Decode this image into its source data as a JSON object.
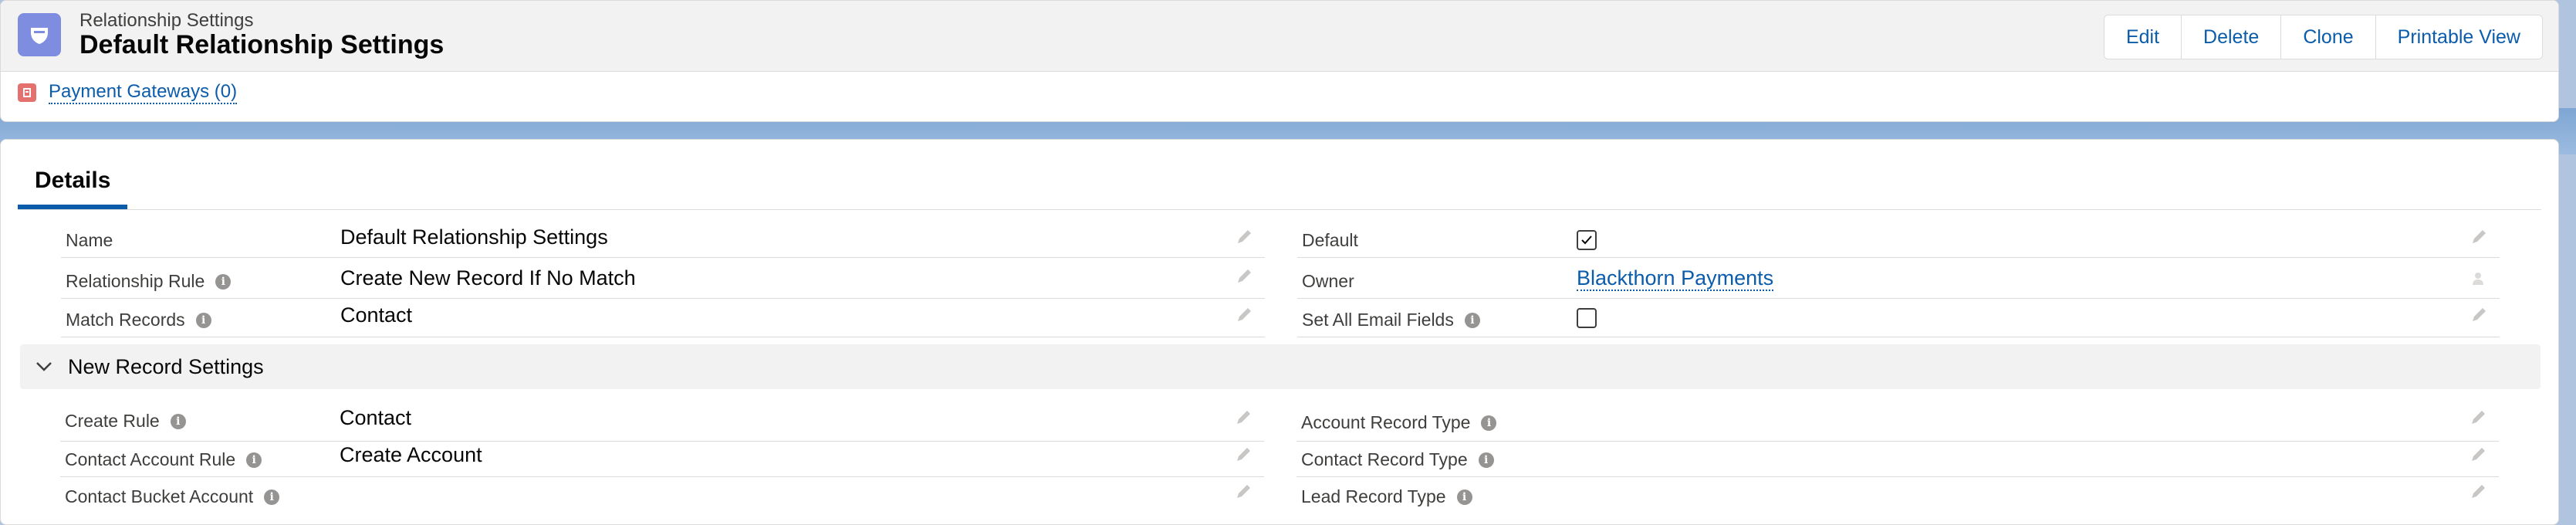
{
  "header": {
    "eyebrow": "Relationship Settings",
    "title": "Default Relationship Settings",
    "buttons": [
      "Edit",
      "Delete",
      "Clone",
      "Printable View"
    ],
    "related_link": "Payment Gateways (0)"
  },
  "tabs": {
    "active": "Details"
  },
  "fields": {
    "name": {
      "label": "Name",
      "value": "Default Relationship Settings"
    },
    "relationship_rule": {
      "label": "Relationship Rule",
      "value": "Create New Record If No Match"
    },
    "match_records": {
      "label": "Match Records",
      "value": "Contact"
    },
    "default": {
      "label": "Default",
      "checked": true
    },
    "owner": {
      "label": "Owner",
      "value": "Blackthorn Payments"
    },
    "set_all_email": {
      "label": "Set All Email Fields",
      "checked": false
    }
  },
  "section": {
    "title": "New Record Settings"
  },
  "section_fields": {
    "create_rule": {
      "label": "Create Rule",
      "value": "Contact"
    },
    "contact_account_rule": {
      "label": "Contact Account Rule",
      "value": "Create Account"
    },
    "contact_bucket_account": {
      "label": "Contact Bucket Account",
      "value": ""
    },
    "account_record_type": {
      "label": "Account Record Type",
      "value": ""
    },
    "contact_record_type": {
      "label": "Contact Record Type",
      "value": ""
    },
    "lead_record_type": {
      "label": "Lead Record Type",
      "value": ""
    }
  },
  "colors": {
    "brand": "#0b5cab",
    "object_icon": "#7f8de1",
    "related_icon": "#e4716e"
  }
}
